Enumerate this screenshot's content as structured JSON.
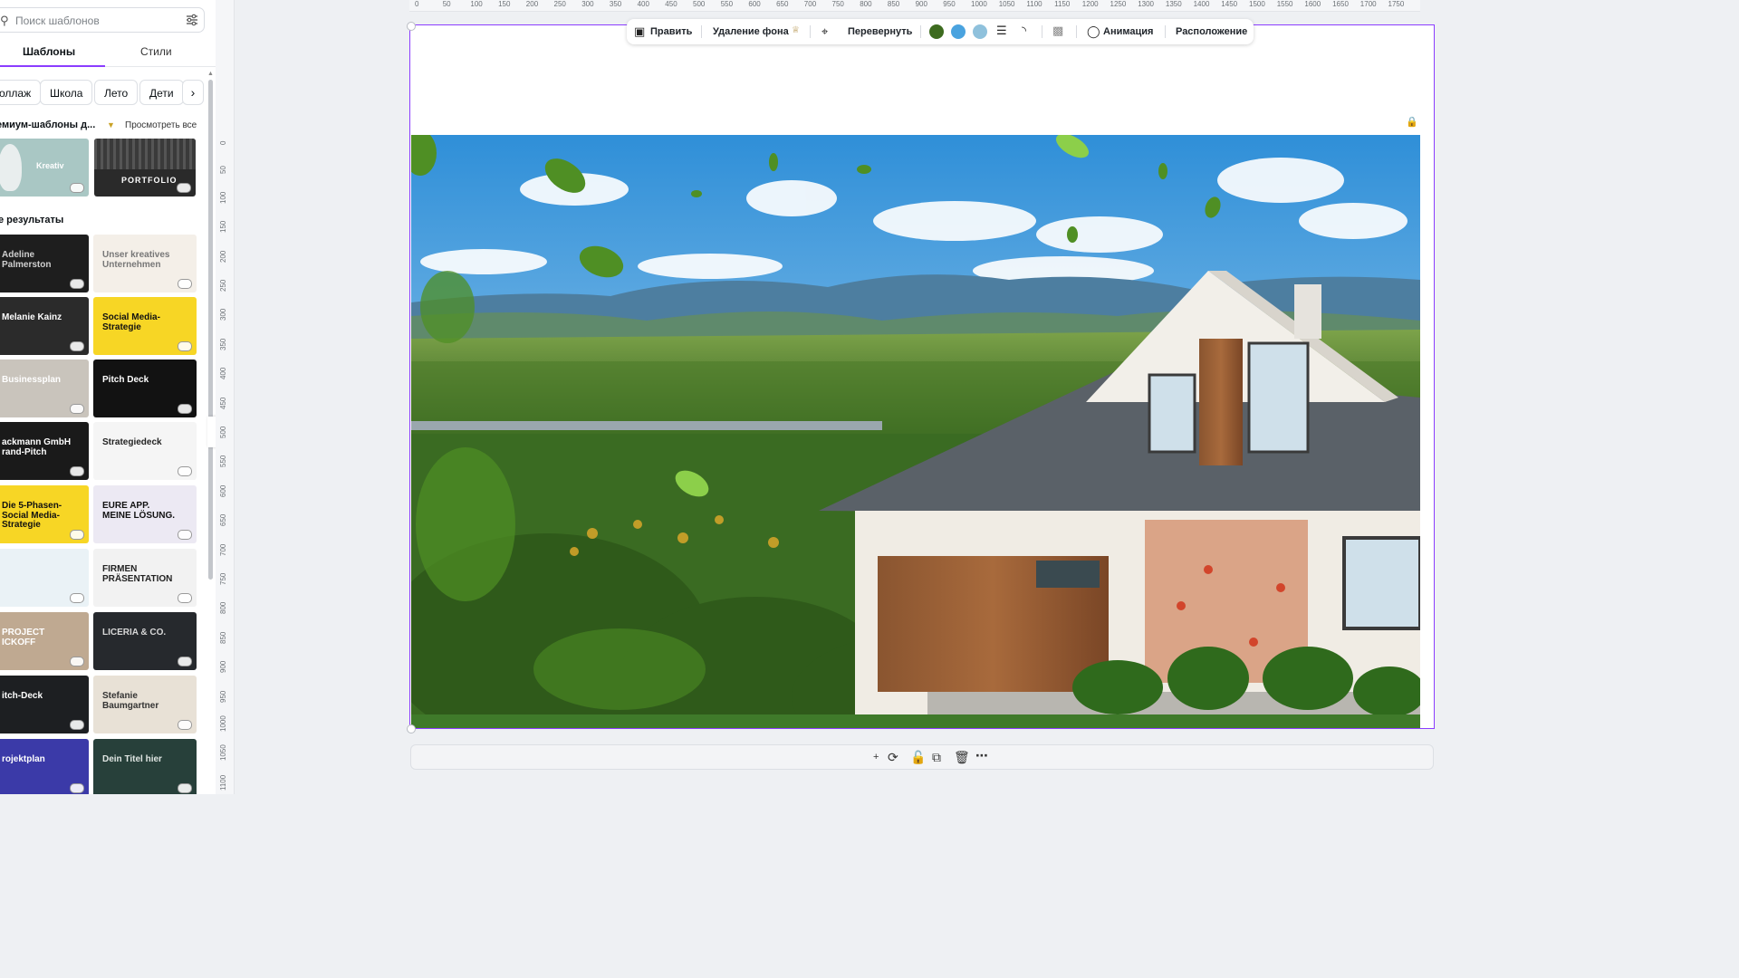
{
  "sidebar": {
    "search_placeholder": "Поиск шаблонов",
    "tabs": [
      "Шаблоны",
      "Стили"
    ],
    "chips": [
      "оллаж",
      "Школа",
      "Лето",
      "Дети"
    ],
    "section_premium": "емиум-шаблоны д...",
    "view_all": "Просмотреть все",
    "section_results": "е результаты",
    "premium_thumbs": [
      {
        "title": "Kreativ",
        "bg": "#a9c7c4",
        "fg": "#ffffff"
      },
      {
        "title": "PORTFOLIO",
        "bg": "#2a2a2a",
        "fg": "#ffffff"
      }
    ],
    "thumbs": [
      {
        "title": "Adeline Palmerston",
        "bg": "#1e1e1e",
        "fg": "#cfcfcf"
      },
      {
        "title": "Unser kreatives Unternehmen",
        "bg": "#f4efe8",
        "fg": "#777777"
      },
      {
        "title": "Melanie Kainz",
        "bg": "#2b2b2b",
        "fg": "#ffffff"
      },
      {
        "title": "Social Media-Strategie",
        "bg": "#f7d625",
        "fg": "#111111"
      },
      {
        "title": "Businessplan",
        "bg": "#c9c4bc",
        "fg": "#ffffff"
      },
      {
        "title": "Pitch Deck",
        "bg": "#121212",
        "fg": "#ffffff"
      },
      {
        "title": "ackmann GmbH rand-Pitch",
        "bg": "#1a1a1a",
        "fg": "#ffffff"
      },
      {
        "title": "Strategiedeck",
        "bg": "#f5f5f5",
        "fg": "#222222"
      },
      {
        "title": "Die 5-Phasen-Social Media-Strategie",
        "bg": "#f7d625",
        "fg": "#111111"
      },
      {
        "title": "EURE APP. MEINE LÖSUNG.",
        "bg": "#ece9f3",
        "fg": "#111111"
      },
      {
        "title": "",
        "bg": "#eaf2f6",
        "fg": "#333333"
      },
      {
        "title": "FIRMEN PRÄSENTATION",
        "bg": "#f2f2f2",
        "fg": "#222222"
      },
      {
        "title": "PROJECT ICKOFF",
        "bg": "#bfa991",
        "fg": "#ffffff"
      },
      {
        "title": "LICERIA & CO.",
        "bg": "#26292d",
        "fg": "#d8d8d8"
      },
      {
        "title": "itch-Deck",
        "bg": "#1d1f22",
        "fg": "#ffffff"
      },
      {
        "title": "Stefanie Baumgartner",
        "bg": "#e8e1d6",
        "fg": "#333333"
      },
      {
        "title": "rojektplan",
        "bg": "#3b3aa8",
        "fg": "#ffffff"
      },
      {
        "title": "Dein Titel hier",
        "bg": "#27403a",
        "fg": "#e0e6e3"
      }
    ]
  },
  "ruler": {
    "h_labels": [
      "0",
      "50",
      "100",
      "150",
      "200",
      "250",
      "300",
      "350",
      "400",
      "450",
      "500",
      "550",
      "600",
      "650",
      "700",
      "750",
      "800",
      "850",
      "900",
      "950",
      "1000",
      "1050",
      "1100",
      "1150",
      "1200",
      "1250",
      "1300",
      "1350",
      "1400",
      "1450",
      "1500",
      "1550",
      "1600",
      "1650",
      "1700",
      "1750"
    ],
    "v_labels": [
      "0",
      "50",
      "100",
      "150",
      "200",
      "250",
      "300",
      "350",
      "400",
      "450",
      "500",
      "550",
      "600",
      "650",
      "700",
      "750",
      "800",
      "850",
      "900",
      "950",
      "1000",
      "1050",
      "1100"
    ]
  },
  "toolbar": {
    "edit": "Править",
    "bg_remove": "Удаление фона",
    "flip": "Перевернуть",
    "animation": "Анимация",
    "position": "Расположение",
    "swatches": [
      "#3d6b1f",
      "#4aa3df",
      "#8fc1dc"
    ]
  }
}
